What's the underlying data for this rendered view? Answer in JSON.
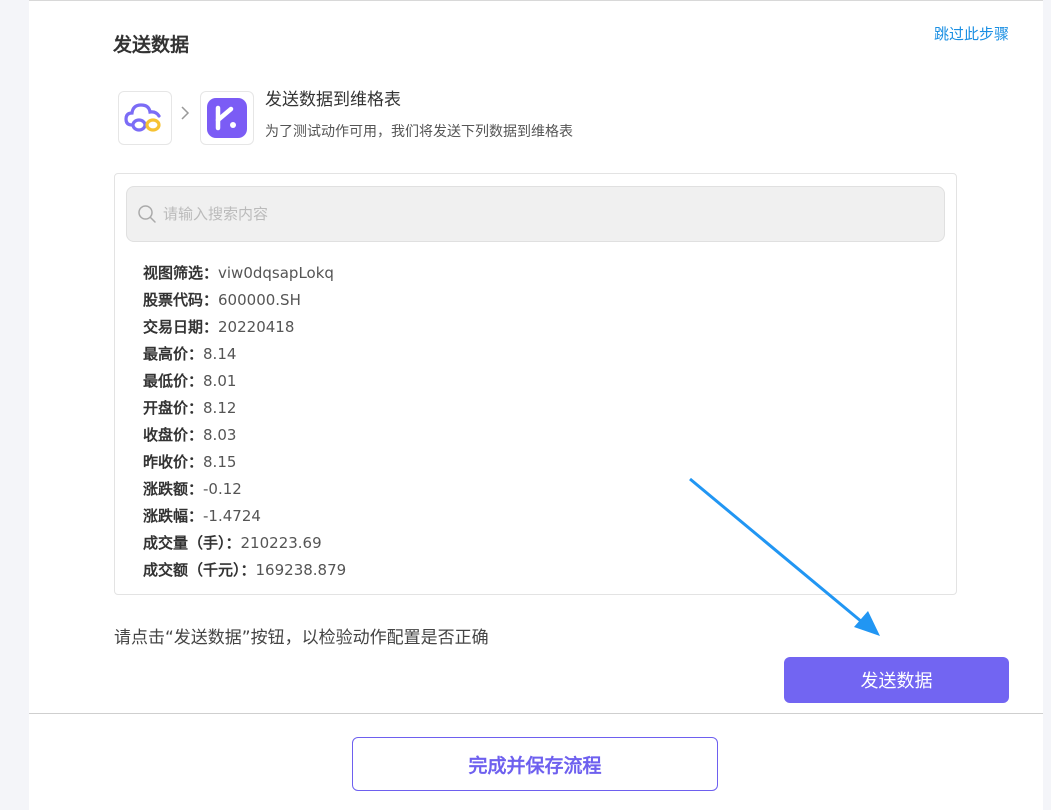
{
  "header": {
    "title": "发送数据",
    "skip_label": "跳过此步骤"
  },
  "flow": {
    "source_icon": "cloud-infinity-logo",
    "connector_icon": "chevron-right-icon",
    "target_icon": "vika-logo",
    "target_title": "发送数据到维格表",
    "target_description": "为了测试动作可用，我们将发送下列数据到维格表"
  },
  "search": {
    "placeholder": "请输入搜索内容",
    "value": ""
  },
  "fields": [
    {
      "label": "视图筛选：",
      "value": "viw0dqsapLokq"
    },
    {
      "label": "股票代码：",
      "value": "600000.SH"
    },
    {
      "label": "交易日期：",
      "value": "20220418"
    },
    {
      "label": "最高价：",
      "value": "8.14"
    },
    {
      "label": "最低价：",
      "value": "8.01"
    },
    {
      "label": "开盘价：",
      "value": "8.12"
    },
    {
      "label": "收盘价：",
      "value": "8.03"
    },
    {
      "label": "昨收价：",
      "value": "8.15"
    },
    {
      "label": "涨跌额：",
      "value": "-0.12"
    },
    {
      "label": "涨跌幅：",
      "value": "-1.4724"
    },
    {
      "label": "成交量（手）：",
      "value": "210223.69"
    },
    {
      "label": "成交额（千元）：",
      "value": "169238.879"
    }
  ],
  "hint_text": "请点击“发送数据”按钮，以检验动作配置是否正确",
  "actions": {
    "send_label": "发送数据",
    "finish_label": "完成并保存流程"
  },
  "colors": {
    "accent": "#7265f2",
    "link": "#1a8fe3",
    "annotation_arrow": "#2196f3"
  }
}
